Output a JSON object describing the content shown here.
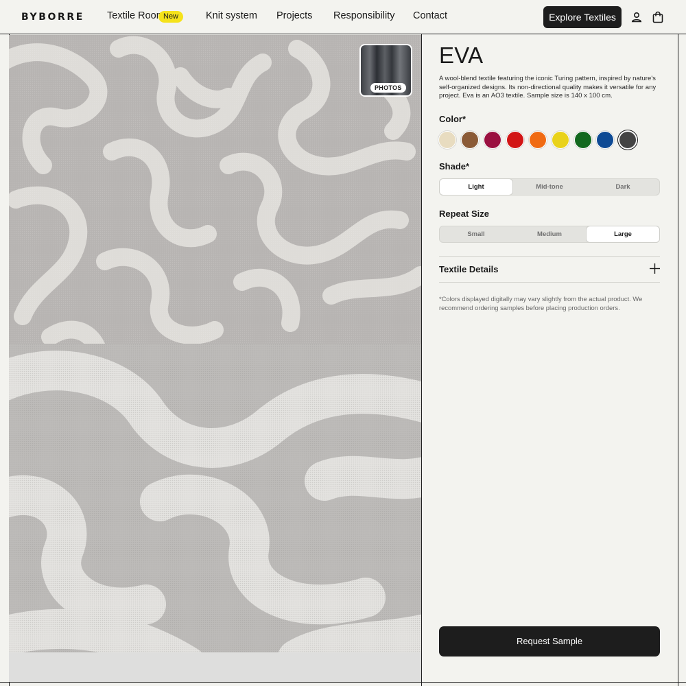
{
  "header": {
    "logo": "BYBORRE",
    "nav": [
      {
        "label": "Textile Room",
        "badge": "New"
      },
      {
        "label": "Knit system"
      },
      {
        "label": "Projects"
      },
      {
        "label": "Responsibility"
      },
      {
        "label": "Contact"
      }
    ],
    "cta": "Explore Textiles",
    "icons": [
      "user-icon",
      "shopping-bag-icon"
    ]
  },
  "gallery": {
    "photos_label": "PHOTOS"
  },
  "product": {
    "name": "EVA",
    "description": "A wool-blend textile featuring the iconic Turing pattern, inspired by nature's self-organized designs. Its non-directional quality makes it versatile for any project. Eva is an AO3 textile. Sample size is 140 x 100 cm.",
    "color_label": "Color*",
    "colors": [
      "#e8dcc0",
      "#8a5a36",
      "#9a1040",
      "#d21515",
      "#f06a12",
      "#e9d21a",
      "#12681e",
      "#0e4a94",
      "#444444"
    ],
    "selected_color_index": 8,
    "shade_label": "Shade*",
    "shades": [
      "Light",
      "Mid-tone",
      "Dark"
    ],
    "selected_shade": "Light",
    "repeat_label": "Repeat Size",
    "repeat_sizes": [
      "Small",
      "Medium",
      "Large"
    ],
    "selected_repeat": "Large",
    "details_label": "Textile Details",
    "disclaimer": "*Colors displayed digitally may vary slightly from the actual product. We recommend ordering samples before placing production orders.",
    "request_label": "Request Sample"
  }
}
